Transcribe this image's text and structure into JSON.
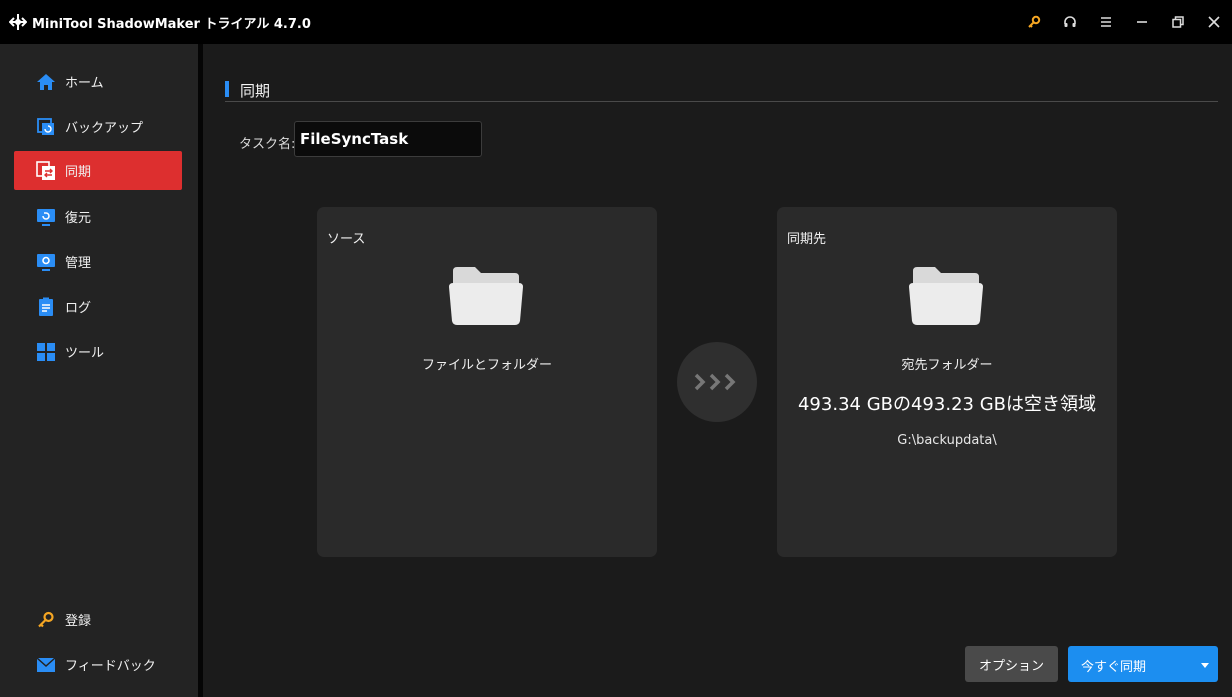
{
  "titlebar": {
    "app_title": "MiniTool ShadowMaker トライアル 4.7.0",
    "icons": [
      "logo-icon",
      "key-icon",
      "headset-icon",
      "menu-icon",
      "minimize-icon",
      "restore-icon",
      "close-icon"
    ]
  },
  "sidebar": {
    "items": [
      {
        "label": "ホーム",
        "icon": "home-icon"
      },
      {
        "label": "バックアップ",
        "icon": "backup-icon"
      },
      {
        "label": "同期",
        "icon": "sync-icon",
        "active": true
      },
      {
        "label": "復元",
        "icon": "restore-icon"
      },
      {
        "label": "管理",
        "icon": "manage-icon"
      },
      {
        "label": "ログ",
        "icon": "log-icon"
      },
      {
        "label": "ツール",
        "icon": "tools-icon"
      }
    ],
    "bottom_items": [
      {
        "label": "登録",
        "icon": "key-icon"
      },
      {
        "label": "フィードバック",
        "icon": "mail-icon"
      }
    ]
  },
  "main": {
    "section_title": "同期",
    "task_name_label": "タスク名:",
    "task_name_value": "FileSyncTask",
    "source": {
      "title": "ソース",
      "subtitle": "ファイルとフォルダー"
    },
    "destination": {
      "title": "同期先",
      "subtitle": "宛先フォルダー",
      "space": "493.34 GBの493.23 GBは空き領域",
      "path": "G:\\backupdata\\"
    },
    "options_button": "オプション",
    "sync_now_button": "今すぐ同期"
  },
  "colors": {
    "accent_blue": "#1c8ef0",
    "active_red": "#dd2f2f",
    "key_yellow": "#f5a623"
  }
}
